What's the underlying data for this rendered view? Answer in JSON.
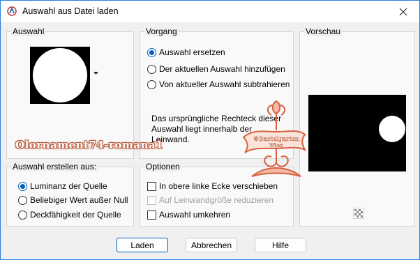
{
  "window": {
    "title": "Auswahl aus Datei laden"
  },
  "groups": {
    "auswahl": {
      "label": "Auswahl"
    },
    "vorgang": {
      "label": "Vorgang",
      "options": [
        {
          "label": "Auswahl ersetzen",
          "checked": true
        },
        {
          "label": "Der aktuellen Auswahl hinzufügen",
          "checked": false
        },
        {
          "label": "Von aktueller Auswahl subtrahieren",
          "checked": false
        }
      ],
      "info_lines": [
        "Das ursprüngliche Rechteck dieser",
        "Auswahl liegt innerhalb der",
        "Leinwand."
      ]
    },
    "vorschau": {
      "label": "Vorschau"
    },
    "erstellen": {
      "label": "Auswahl erstellen aus:",
      "options": [
        {
          "label": "Luminanz der Quelle",
          "checked": true
        },
        {
          "label": "Beliebiger Wert außer Null",
          "checked": false
        },
        {
          "label": "Deckfähigkeit der Quelle",
          "checked": false
        }
      ]
    },
    "optionen": {
      "label": "Optionen",
      "checks": [
        {
          "label": "In obere linke Ecke verschieben",
          "checked": false,
          "disabled": false
        },
        {
          "label": "Auf Leinwandgröße reduzieren",
          "checked": false,
          "disabled": true
        },
        {
          "label": "Auswahl umkehren",
          "checked": false,
          "disabled": false
        }
      ]
    }
  },
  "buttons": {
    "ok": "Laden",
    "cancel": "Abbrechen",
    "help": "Hilfe"
  },
  "watermark": {
    "text": "Olornament74-romana1",
    "stamp_line1": "©Bastelgarten",
    "stamp_line2": "Wien"
  },
  "icons": {
    "app": "psp-app-icon",
    "close": "close-icon",
    "dropdown": "chevron-down-icon",
    "checker": "transparency-checker-icon"
  },
  "colors": {
    "accent": "#005fb8",
    "ornament": "#d8613f"
  }
}
